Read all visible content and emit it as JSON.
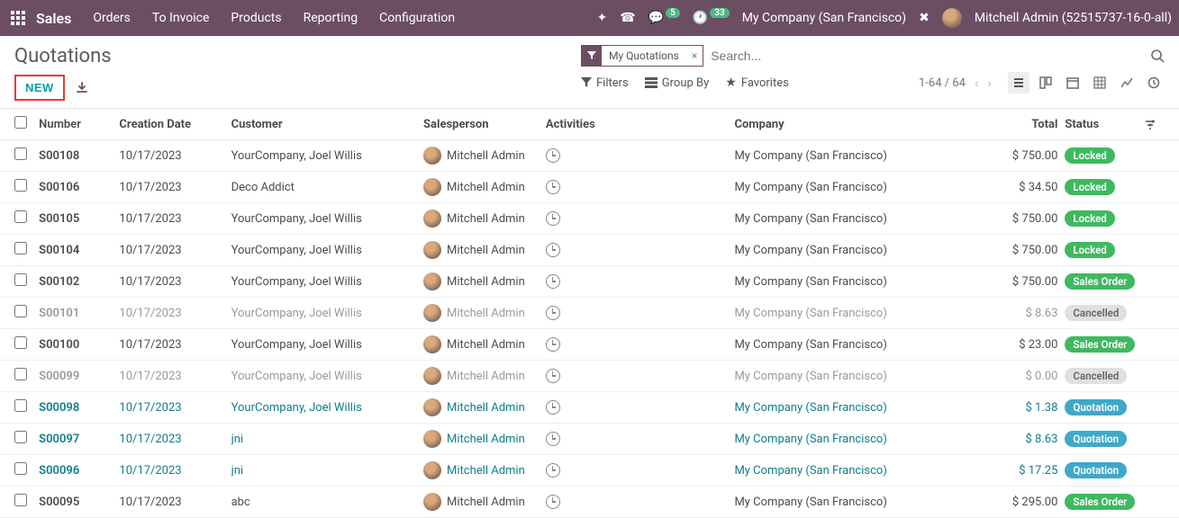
{
  "topbar": {
    "app_name": "Sales",
    "nav": [
      "Orders",
      "To Invoice",
      "Products",
      "Reporting",
      "Configuration"
    ],
    "msg_badge": "5",
    "activity_badge": "33",
    "company": "My Company (San Francisco)",
    "user": "Mitchell Admin (52515737-16-0-all)"
  },
  "header": {
    "title": "Quotations",
    "new_btn": "NEW",
    "search_placeholder": "Search...",
    "filter_chip": "My Quotations",
    "filters_label": "Filters",
    "groupby_label": "Group By",
    "favorites_label": "Favorites",
    "pager": "1-64 / 64"
  },
  "columns": {
    "number": "Number",
    "date": "Creation Date",
    "customer": "Customer",
    "salesperson": "Salesperson",
    "activities": "Activities",
    "company": "Company",
    "total": "Total",
    "status": "Status"
  },
  "status_labels": {
    "locked": "Locked",
    "sales_order": "Sales Order",
    "cancelled": "Cancelled",
    "quotation": "Quotation"
  },
  "rows": [
    {
      "num": "S00108",
      "date": "10/17/2023",
      "cust": "YourCompany, Joel Willis",
      "sales": "Mitchell Admin",
      "comp": "My Company (San Francisco)",
      "total": "$ 750.00",
      "status": "locked",
      "style": "normal"
    },
    {
      "num": "S00106",
      "date": "10/17/2023",
      "cust": "Deco Addict",
      "sales": "Mitchell Admin",
      "comp": "My Company (San Francisco)",
      "total": "$ 34.50",
      "status": "locked",
      "style": "normal"
    },
    {
      "num": "S00105",
      "date": "10/17/2023",
      "cust": "YourCompany, Joel Willis",
      "sales": "Mitchell Admin",
      "comp": "My Company (San Francisco)",
      "total": "$ 750.00",
      "status": "locked",
      "style": "normal"
    },
    {
      "num": "S00104",
      "date": "10/17/2023",
      "cust": "YourCompany, Joel Willis",
      "sales": "Mitchell Admin",
      "comp": "My Company (San Francisco)",
      "total": "$ 750.00",
      "status": "locked",
      "style": "normal"
    },
    {
      "num": "S00102",
      "date": "10/17/2023",
      "cust": "YourCompany, Joel Willis",
      "sales": "Mitchell Admin",
      "comp": "My Company (San Francisco)",
      "total": "$ 750.00",
      "status": "sales_order",
      "style": "normal"
    },
    {
      "num": "S00101",
      "date": "10/17/2023",
      "cust": "YourCompany, Joel Willis",
      "sales": "Mitchell Admin",
      "comp": "My Company (San Francisco)",
      "total": "$ 8.63",
      "status": "cancelled",
      "style": "muted"
    },
    {
      "num": "S00100",
      "date": "10/17/2023",
      "cust": "YourCompany, Joel Willis",
      "sales": "Mitchell Admin",
      "comp": "My Company (San Francisco)",
      "total": "$ 23.00",
      "status": "sales_order",
      "style": "normal"
    },
    {
      "num": "S00099",
      "date": "10/17/2023",
      "cust": "YourCompany, Joel Willis",
      "sales": "Mitchell Admin",
      "comp": "My Company (San Francisco)",
      "total": "$ 0.00",
      "status": "cancelled",
      "style": "muted"
    },
    {
      "num": "S00098",
      "date": "10/17/2023",
      "cust": "YourCompany, Joel Willis",
      "sales": "Mitchell Admin",
      "comp": "My Company (San Francisco)",
      "total": "$ 1.38",
      "status": "quotation",
      "style": "link"
    },
    {
      "num": "S00097",
      "date": "10/17/2023",
      "cust": "jni",
      "sales": "Mitchell Admin",
      "comp": "My Company (San Francisco)",
      "total": "$ 8.63",
      "status": "quotation",
      "style": "link"
    },
    {
      "num": "S00096",
      "date": "10/17/2023",
      "cust": "jni",
      "sales": "Mitchell Admin",
      "comp": "My Company (San Francisco)",
      "total": "$ 17.25",
      "status": "quotation",
      "style": "link"
    },
    {
      "num": "S00095",
      "date": "10/17/2023",
      "cust": "abc",
      "sales": "Mitchell Admin",
      "comp": "My Company (San Francisco)",
      "total": "$ 295.00",
      "status": "sales_order",
      "style": "normal"
    }
  ]
}
